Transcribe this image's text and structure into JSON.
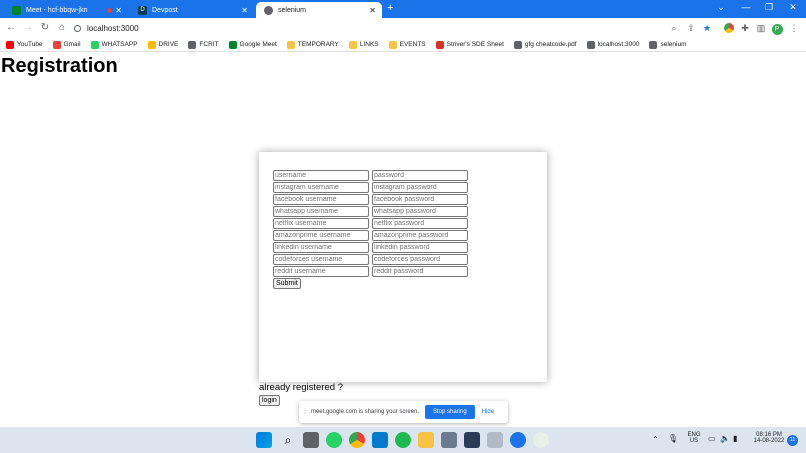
{
  "browser": {
    "tabs": [
      {
        "label": "Meet - hcf-bbqw-jkn",
        "favicon_color": "#00832d",
        "active": false
      },
      {
        "label": "Devpost",
        "favicon_color": "#003e54",
        "active": false
      },
      {
        "label": "selenium",
        "favicon_color": "#5f6368",
        "active": true
      }
    ],
    "new_tab": "+",
    "window_controls": [
      "⌄",
      "—",
      "❐",
      "✕"
    ],
    "url": "localhost:3000",
    "profile_initial": "P"
  },
  "bookmarks": [
    {
      "label": "YouTube",
      "color": "#ff0000"
    },
    {
      "label": "Gmail",
      "color": "#ea4335"
    },
    {
      "label": "WHATSAPP",
      "color": "#25d366"
    },
    {
      "label": "DRIVE",
      "color": "#fbbc04"
    },
    {
      "label": "FCRIT",
      "color": "#5f6368"
    },
    {
      "label": "Google Meet",
      "color": "#00832d"
    },
    {
      "label": "TEMPORARY",
      "color": "#f6c344"
    },
    {
      "label": "LINKS",
      "color": "#f6c344"
    },
    {
      "label": "EVENTS",
      "color": "#f6c344"
    },
    {
      "label": "Striver's SDE Sheet",
      "color": "#d93025"
    },
    {
      "label": "gfg cheatcode.pdf",
      "color": "#5f6368"
    },
    {
      "label": "localhost:3000",
      "color": "#5f6368"
    },
    {
      "label": "selenium",
      "color": "#5f6368"
    }
  ],
  "page": {
    "title": "Registration",
    "form": {
      "rows": [
        {
          "left": "username",
          "right": "password"
        },
        {
          "left": "instagram username",
          "right": "instagram password"
        },
        {
          "left": "facebook username",
          "right": "facebook password"
        },
        {
          "left": "whatsapp username",
          "right": "whatsapp password"
        },
        {
          "left": "netflix username",
          "right": "netflix password"
        },
        {
          "left": "amazonprime username",
          "right": "amazonprime password"
        },
        {
          "left": "linkedin username",
          "right": "linkedin password"
        },
        {
          "left": "codeforces username",
          "right": "codeforces password"
        },
        {
          "left": "reddit username",
          "right": "reddit password"
        }
      ],
      "submit_label": "Submit"
    },
    "already_registered": "already registered ?",
    "login_label": "login"
  },
  "share_bar": {
    "message": "meet.google.com is sharing your screen.",
    "stop_label": "Stop sharing",
    "hide_label": "Hide"
  },
  "taskbar": {
    "lang_top": "ENG",
    "lang_bottom": "US",
    "time": "08:16 PM",
    "date": "14-08-2022",
    "notification_count": "11"
  }
}
